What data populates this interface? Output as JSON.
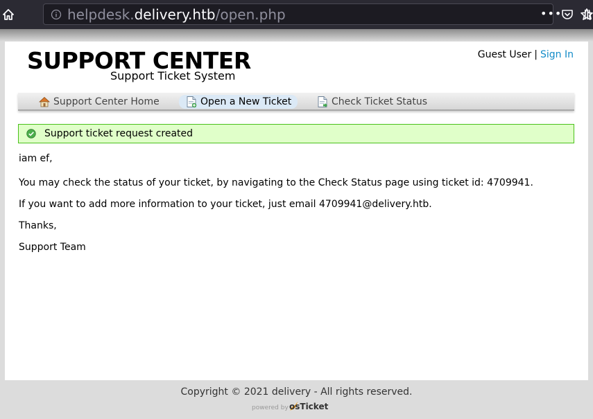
{
  "browser": {
    "url_prefix": "helpdesk.",
    "url_domain": "delivery.htb",
    "url_path": "/open.php"
  },
  "header": {
    "title": "SUPPORT CENTER",
    "subtitle": "Support Ticket System",
    "user_label": "Guest User",
    "separator": "|",
    "signin_label": "Sign In"
  },
  "nav": {
    "items": [
      {
        "label": "Support Center Home",
        "icon": "home-icon"
      },
      {
        "label": "Open a New Ticket",
        "icon": "new-ticket-icon"
      },
      {
        "label": "Check Ticket Status",
        "icon": "ticket-status-icon"
      }
    ]
  },
  "notice": {
    "text": "Support ticket request created"
  },
  "message": {
    "greeting": "iam ef,",
    "line1": "You may check the status of your ticket, by navigating to the Check Status page using ticket id: 4709941.",
    "line2": "If you want to add more information to your ticket, just email 4709941@delivery.htb.",
    "thanks": "Thanks,",
    "signature": "Support Team"
  },
  "footer": {
    "copyright": "Copyright © 2021 delivery - All rights reserved.",
    "powered_by": "powered by",
    "brand": "osTicket"
  },
  "colors": {
    "link": "#128bc8",
    "notice_bg": "#e0ffc9",
    "notice_border": "#49c01a"
  }
}
